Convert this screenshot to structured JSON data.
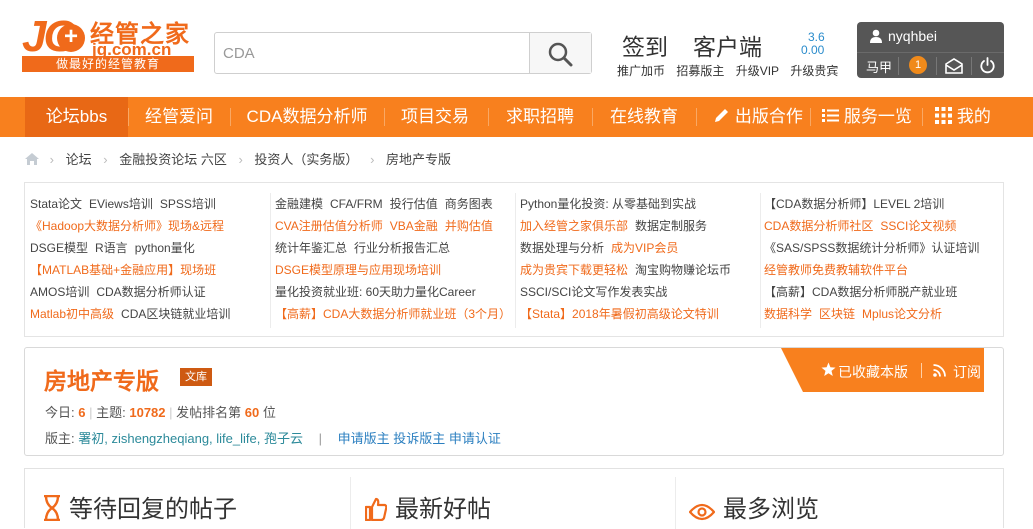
{
  "logo": {
    "jg": "JG",
    "cn": "经管之家",
    "domain": "jg.com.cn",
    "slogan": "做最好的经管教育"
  },
  "search": {
    "value": "CDA"
  },
  "header": {
    "checkin": "签到",
    "client": "客户端",
    "value1": "3.6",
    "value2": "0.00",
    "links": [
      "推广加币",
      "招募版主",
      "升级VIP",
      "升级贵宾"
    ]
  },
  "user": {
    "name": "nyqhbei",
    "mj": "马甲",
    "notif": "1"
  },
  "nav": [
    "论坛bbs",
    "经管爱问",
    "CDA数据分析师",
    "项目交易",
    "求职招聘",
    "在线教育",
    "出版合作",
    "服务一览",
    "我的"
  ],
  "breadcrumb": [
    "论坛",
    "金融投资论坛 六区",
    "投资人（实务版）",
    "房地产专版"
  ],
  "ads": {
    "col1": [
      [
        "Stata论文",
        "EViews培训",
        "SPSS培训"
      ],
      [
        "《Hadoop大数据分析师》现场&远程"
      ],
      [
        "DSGE模型",
        "R语言",
        "python量化"
      ],
      [
        "【MATLAB基础+金融应用】现场班"
      ],
      [
        "AMOS培训",
        "CDA数据分析师认证"
      ],
      [
        "Matlab初中高级",
        "CDA区块链就业培训"
      ]
    ],
    "col2": [
      [
        "金融建模",
        "CFA/FRM",
        "投行估值",
        "商务图表"
      ],
      [
        "CVA注册估值分析师",
        "VBA金融",
        "并购估值"
      ],
      [
        "统计年鉴汇总",
        "行业分析报告汇总"
      ],
      [
        "DSGE模型原理与应用现场培训"
      ],
      [
        "量化投资就业班: 60天助力量化Career"
      ],
      [
        "【高薪】CDA大数据分析师就业班（3个月）"
      ]
    ],
    "col3": [
      [
        "Python量化投资: 从零基础到实战"
      ],
      [
        "加入经管之家俱乐部",
        "数据定制服务"
      ],
      [
        "数据处理与分析",
        "成为VIP会员"
      ],
      [
        "成为贵宾下载更轻松",
        "淘宝购物赚论坛币"
      ],
      [
        "SSCI/SCI论文写作发表实战"
      ],
      [
        "【Stata】2018年暑假初高级论文特训"
      ]
    ],
    "col4": [
      [
        "【CDA数据分析师】LEVEL 2培训"
      ],
      [
        "CDA数据分析师社区",
        "SSCI论文视频"
      ],
      [
        "《SAS/SPSS数据统计分析师》认证培训"
      ],
      [
        "经管教师免费教辅软件平台"
      ],
      [
        "【高薪】CDA数据分析师脱产就业班"
      ],
      [
        "数据科学",
        "区块链",
        "Mplus论文分析"
      ]
    ]
  },
  "forum": {
    "title": "房地产专版",
    "tag": "文库",
    "today_label": "今日:",
    "today": "6",
    "topics_label": "主题:",
    "topics": "10782",
    "rank_label": "发帖排名第",
    "rank": "60",
    "rank_unit": "位",
    "mods_label": "版主:",
    "mods": "署初, zishengzheqiang, life_life, 孢子云",
    "apply": "申请版主",
    "complain": "投诉版主",
    "verify": "申请认证",
    "faved": "已收藏本版",
    "subscribe": "订阅"
  },
  "sections": [
    "等待回复的帖子",
    "最新好帖",
    "最多浏览"
  ]
}
